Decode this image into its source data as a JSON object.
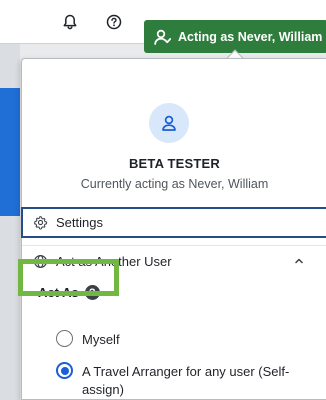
{
  "topbar": {
    "notifications_icon": "bell-icon",
    "help_icon": "help-icon",
    "acting_button_label": "Acting as Never, William",
    "acting_button_color": "#2e7d3c"
  },
  "profile_menu": {
    "avatar_icon": "user-icon",
    "role": "BETA TESTER",
    "acting_status": "Currently acting as Never, William",
    "settings_label": "Settings",
    "act_as_another_user_label": "Act as Another User",
    "act_as": {
      "label": "Act As",
      "help_icon": "question-icon",
      "options": [
        {
          "label": "Myself",
          "selected": false
        },
        {
          "label": "A Travel Arranger for any user (Self-",
          "label_line2": "assign)",
          "selected": true
        }
      ]
    },
    "highlight_color": "#71b843"
  }
}
